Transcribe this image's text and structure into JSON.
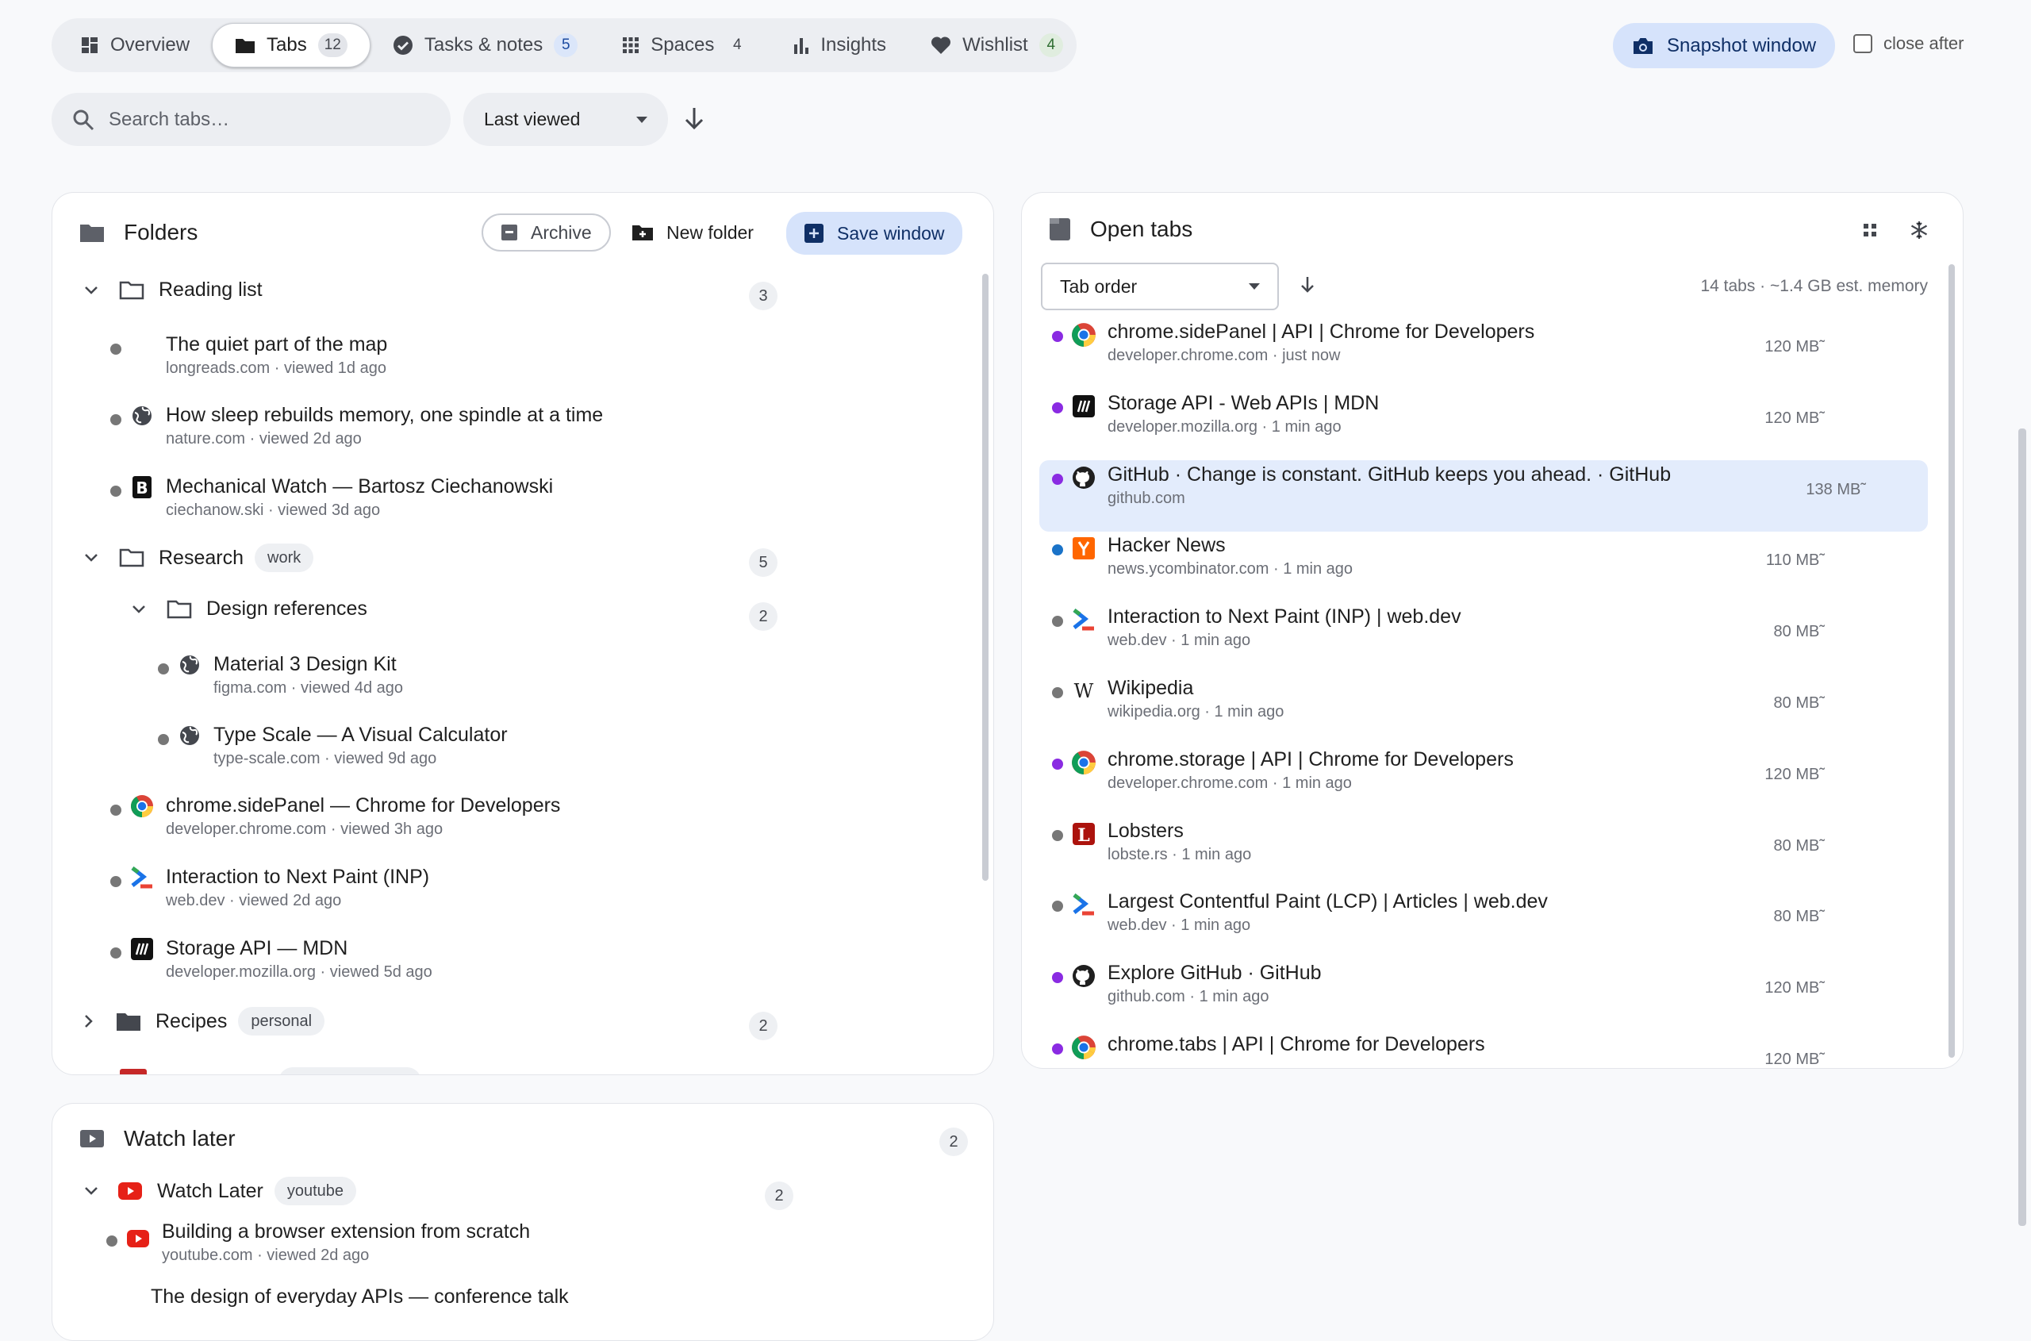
{
  "nav": {
    "tabs": [
      {
        "label": "Overview",
        "count": null
      },
      {
        "label": "Tabs",
        "count": "12"
      },
      {
        "label": "Tasks & notes",
        "count": "5"
      },
      {
        "label": "Spaces",
        "count": "4"
      },
      {
        "label": "Insights",
        "count": null
      },
      {
        "label": "Wishlist",
        "count": "4"
      }
    ],
    "snapshot_label": "Snapshot window",
    "close_after_label": "close after"
  },
  "toolbar": {
    "search_placeholder": "Search tabs…",
    "sort_value": "Last viewed"
  },
  "folders": {
    "title": "Folders",
    "archive_label": "Archive",
    "new_folder_label": "New folder",
    "save_window_label": "Save window",
    "reading_list": {
      "name": "Reading list",
      "count": "3"
    },
    "reading_items": [
      {
        "title": "The quiet part of the map",
        "meta": "longreads.com · viewed 1d ago"
      },
      {
        "title": "How sleep rebuilds memory, one spindle at a time",
        "meta": "nature.com · viewed 2d ago"
      },
      {
        "title": "Mechanical Watch — Bartosz Ciechanowski",
        "meta": "ciechanow.ski · viewed 3d ago"
      }
    ],
    "research": {
      "name": "Research",
      "tag": "work",
      "count": "5"
    },
    "design_refs": {
      "name": "Design references",
      "count": "2"
    },
    "design_items": [
      {
        "title": "Material 3 Design Kit",
        "meta": "figma.com · viewed 4d ago"
      },
      {
        "title": "Type Scale — A Visual Calculator",
        "meta": "type-scale.com · viewed 9d ago"
      }
    ],
    "research_items": [
      {
        "title": "chrome.sidePanel — Chrome for Developers",
        "meta": "developer.chrome.com · viewed 3h ago"
      },
      {
        "title": "Interaction to Next Paint (INP)",
        "meta": "web.dev · viewed 2d ago"
      },
      {
        "title": "Storage API — MDN",
        "meta": "developer.mozilla.org · viewed 5d ago"
      }
    ],
    "recipes": {
      "name": "Recipes",
      "tag": "personal",
      "count": "2"
    }
  },
  "watch_later": {
    "title": "Watch later",
    "count": "2",
    "folder": {
      "name": "Watch Later",
      "tag": "youtube",
      "count": "2"
    },
    "items": [
      {
        "title": "Building a browser extension from scratch",
        "meta": "youtube.com · viewed 2d ago"
      },
      {
        "title": "The design of everyday APIs — conference talk",
        "meta": ""
      }
    ]
  },
  "open_tabs": {
    "title": "Open tabs",
    "order_value": "Tab order",
    "summary": "14 tabs · ~1.4 GB est. memory",
    "tabs": [
      {
        "title": "chrome.sidePanel  |  API  |  Chrome for Developers",
        "meta": "developer.chrome.com · just now",
        "mem": "120 MB˜",
        "dot": "#8a2be2",
        "icon": "chrome-icon"
      },
      {
        "title": "Storage API - Web APIs | MDN",
        "meta": "developer.mozilla.org · 1 min ago",
        "mem": "120 MB˜",
        "dot": "#8a2be2",
        "icon": "mdn-icon"
      },
      {
        "title": "GitHub · Change is constant. GitHub keeps you ahead. · GitHub",
        "meta": "github.com",
        "mem": "138 MB˜",
        "dot": "#8a2be2",
        "icon": "github-icon"
      },
      {
        "title": "Hacker News",
        "meta": "news.ycombinator.com · 1 min ago",
        "mem": "110 MB˜",
        "dot": "#1a73c8",
        "icon": "hackernews-icon"
      },
      {
        "title": "Interaction to Next Paint (INP)  |  web.dev",
        "meta": "web.dev · 1 min ago",
        "mem": "80 MB˜",
        "dot": "#777777",
        "icon": "webdev-icon"
      },
      {
        "title": "Wikipedia",
        "meta": "wikipedia.org · 1 min ago",
        "mem": "80 MB˜",
        "dot": "#777777",
        "icon": "wikipedia-icon"
      },
      {
        "title": "chrome.storage  |  API  |  Chrome for Developers",
        "meta": "developer.chrome.com · 1 min ago",
        "mem": "120 MB˜",
        "dot": "#8a2be2",
        "icon": "chrome-icon"
      },
      {
        "title": "Lobsters",
        "meta": "lobste.rs · 1 min ago",
        "mem": "80 MB˜",
        "dot": "#777777",
        "icon": "lobsters-icon"
      },
      {
        "title": "Largest Contentful Paint (LCP)  |  Articles  |  web.dev",
        "meta": "web.dev · 1 min ago",
        "mem": "80 MB˜",
        "dot": "#777777",
        "icon": "webdev-icon"
      },
      {
        "title": "Explore GitHub · GitHub",
        "meta": "github.com · 1 min ago",
        "mem": "120 MB˜",
        "dot": "#8a2be2",
        "icon": "github-icon"
      },
      {
        "title": "chrome.tabs  |  API  |  Chrome for Developers",
        "meta": "",
        "mem": "120 MB˜",
        "dot": "#8a2be2",
        "icon": "chrome-icon"
      }
    ]
  }
}
